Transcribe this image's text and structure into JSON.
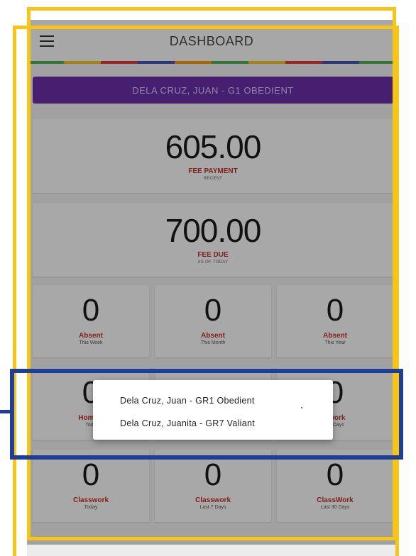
{
  "topbar": {
    "title": "DASHBOARD",
    "stripe_colors": [
      "#4caf50",
      "#f5c518",
      "#e53935",
      "#3f51b5",
      "#ff9800",
      "#4caf50",
      "#f5c518",
      "#e53935",
      "#3f51b5",
      "#4caf50"
    ]
  },
  "student_bar": {
    "label": "DELA CRUZ, JUAN - G1 OBEDIENT",
    "color": "#6a2fa8"
  },
  "fee_payment": {
    "amount": "605.00",
    "label": "FEE PAYMENT",
    "sub": "RECENT"
  },
  "fee_due": {
    "amount": "700.00",
    "label": "FEE DUE",
    "sub": "AS OF TODAY"
  },
  "stats": [
    {
      "value": "0",
      "label": "Absent",
      "sub": "This Week"
    },
    {
      "value": "0",
      "label": "Absent",
      "sub": "This Month"
    },
    {
      "value": "0",
      "label": "Absent",
      "sub": "This Year"
    },
    {
      "value": "0",
      "label": "Homew",
      "sub": "Toda"
    },
    {
      "value": "0",
      "label": "",
      "sub": ""
    },
    {
      "value": "0",
      "label": "ework",
      "sub": "30 Days"
    },
    {
      "value": "0",
      "label": "Classwork",
      "sub": "Today"
    },
    {
      "value": "0",
      "label": "Classwork",
      "sub": "Last 7 Days"
    },
    {
      "value": "0",
      "label": "ClassWork",
      "sub": "Last 30 Days"
    }
  ],
  "student_popup": {
    "items": [
      "Dela Cruz, Juan - GR1 Obedient",
      "Dela Cruz, Juanita - GR7 Valiant"
    ]
  },
  "colors": {
    "label_red": "#c0322a",
    "frame_yellow": "#f5c518",
    "frame_blue": "#1f3e96"
  }
}
